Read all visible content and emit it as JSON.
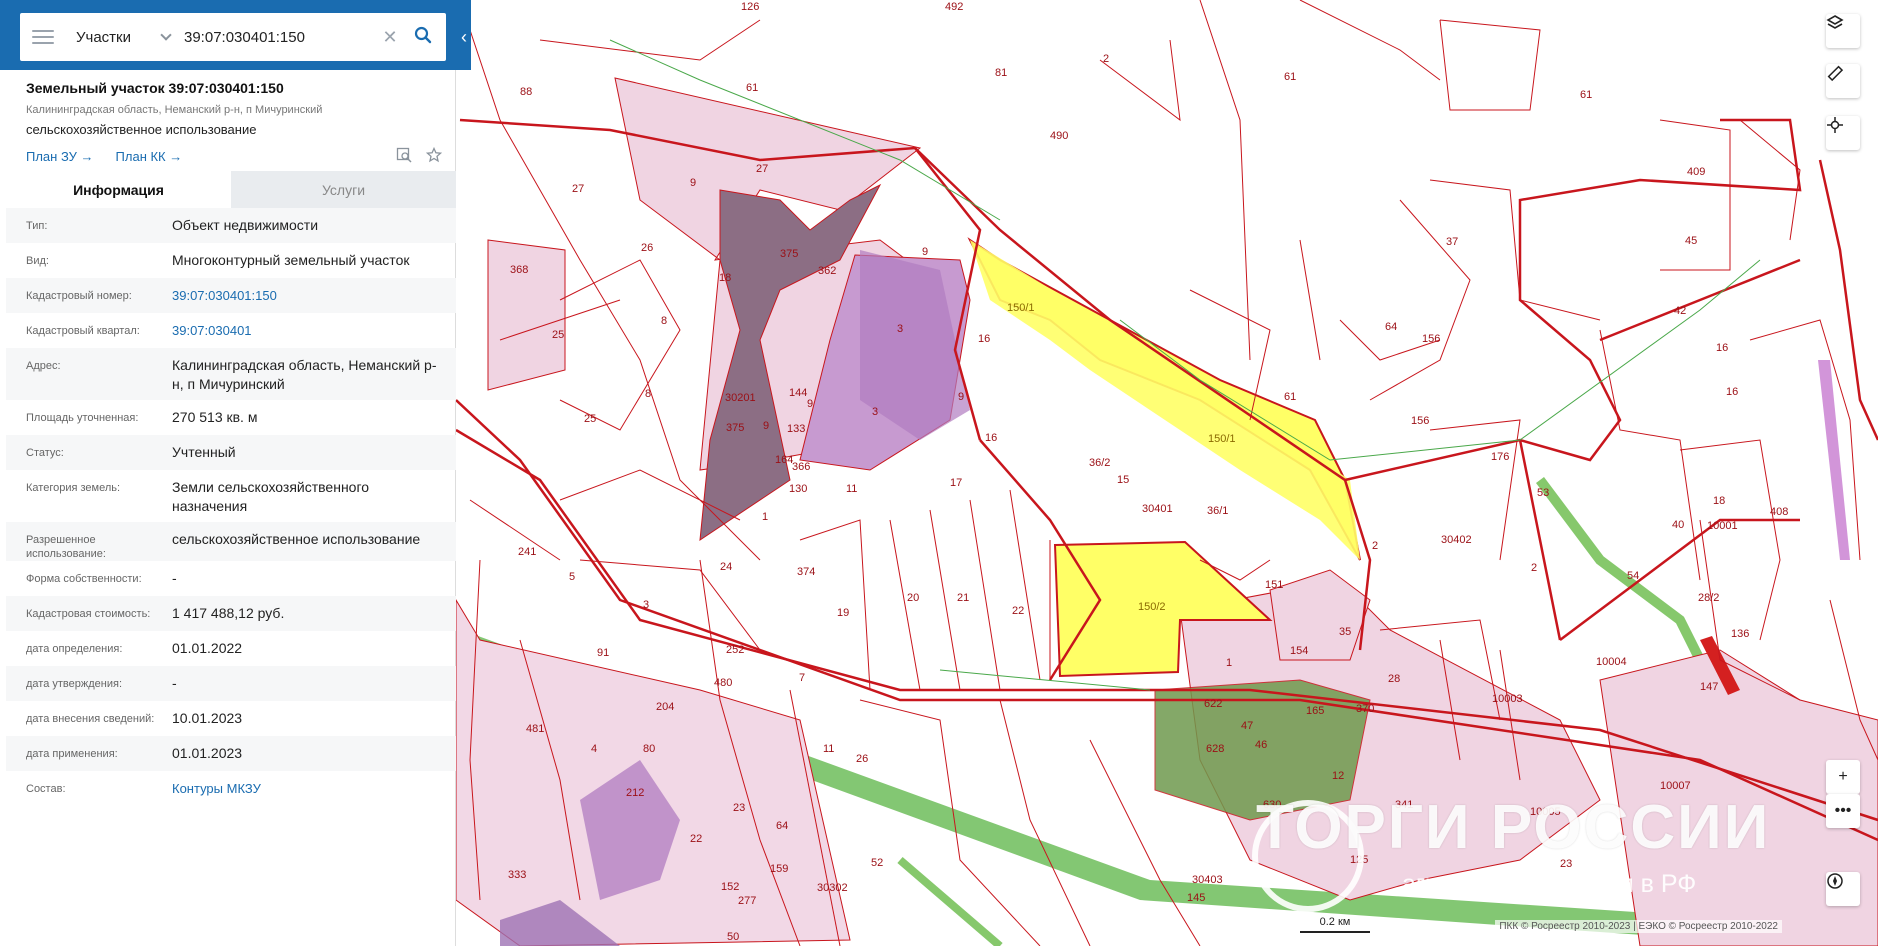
{
  "search": {
    "type_label": "Участки",
    "value": "39:07:030401:150"
  },
  "object": {
    "title": "Земельный участок 39:07:030401:150",
    "address_short": "Калининградская область, Неманский р-н, п Мичуринский",
    "use": "сельскохозяйственное использование",
    "plan_zu": "План ЗУ →",
    "plan_kk": "План КК →"
  },
  "tabs": [
    {
      "label": "Информация",
      "active": true
    },
    {
      "label": "Услуги",
      "active": false
    }
  ],
  "properties": [
    {
      "label": "Тип:",
      "value": "Объект недвижимости",
      "link": false
    },
    {
      "label": "Вид:",
      "value": "Многоконтурный земельный участок",
      "link": false
    },
    {
      "label": "Кадастровый номер:",
      "value": "39:07:030401:150",
      "link": true
    },
    {
      "label": "Кадастровый квартал:",
      "value": "39:07:030401",
      "link": true
    },
    {
      "label": "Адрес:",
      "value": "Калининградская область, Неманский р-н, п Мичуринский",
      "link": false
    },
    {
      "label": "Площадь уточненная:",
      "value": "270 513 кв. м",
      "link": false
    },
    {
      "label": "Статус:",
      "value": "Учтенный",
      "link": false
    },
    {
      "label": "Категория земель:",
      "value": "Земли сельскохозяйственного назначения",
      "link": false
    },
    {
      "label": "Разрешенное использование:",
      "value": "сельскохозяйственное использование",
      "link": false
    },
    {
      "label": "Форма собственности:",
      "value": "-",
      "link": false
    },
    {
      "label": "Кадастровая стоимость:",
      "value": "1 417 488,12 руб.",
      "link": false
    },
    {
      "label": "дата определения:",
      "value": "01.01.2022",
      "link": false
    },
    {
      "label": "дата утверждения:",
      "value": "-",
      "link": false
    },
    {
      "label": "дата внесения сведений:",
      "value": "10.01.2023",
      "link": false
    },
    {
      "label": "дата применения:",
      "value": "01.01.2023",
      "link": false
    },
    {
      "label": "Состав:",
      "value": "Контуры МКЗУ",
      "link": true
    }
  ],
  "map": {
    "scale_label": "0.2 км",
    "copyright": "ПКК © Росреестр 2010-2023 | ЕЭКО © Росреестр 2010-2022",
    "watermark": "ТОРГИ РОССИИ",
    "watermark_sub": "агрегатор по торгам в РФ",
    "labels": [
      "126",
      "492",
      "2",
      "61",
      "88",
      "61",
      "81",
      "490",
      "61",
      "27",
      "27",
      "9",
      "375",
      "362",
      "9",
      "26",
      "18",
      "368",
      "25",
      "8",
      "3",
      "8",
      "25",
      "9",
      "3",
      "150/1",
      "16",
      "64",
      "37",
      "409",
      "45",
      "42",
      "156",
      "16",
      "16",
      "61",
      "156",
      "150/1",
      "30201",
      "144",
      "9",
      "375",
      "133",
      "9",
      "164",
      "366",
      "130",
      "1",
      "11",
      "17",
      "16",
      "36/2",
      "15",
      "30401",
      "36/1",
      "176",
      "53",
      "18",
      "408",
      "40",
      "10001",
      "241",
      "5",
      "24",
      "374",
      "19",
      "20",
      "21",
      "22",
      "150/2",
      "151",
      "2",
      "30402",
      "54",
      "28/2",
      "136",
      "3",
      "91",
      "252",
      "480",
      "7",
      "35",
      "154",
      "1",
      "28",
      "10003",
      "10004",
      "147",
      "481",
      "4",
      "204",
      "11",
      "26",
      "622",
      "47",
      "628",
      "165",
      "46",
      "12",
      "630",
      "10005",
      "10007",
      "80",
      "212",
      "22",
      "64",
      "52",
      "30302",
      "341",
      "125",
      "23",
      "30403",
      "145",
      "333",
      "481",
      "50",
      "277",
      "152",
      "159",
      "23",
      "370"
    ],
    "colors": {
      "boundary": "#c8161d",
      "selected": "#ffff66",
      "pink": "#f0d4e2",
      "purple": "#b07cc0",
      "dark": "#8a6a80",
      "green": "#7bbf5e",
      "forest": "#6f9a4e"
    }
  },
  "icons": [
    "menu-icon",
    "chevron-down-icon",
    "clear-icon",
    "search-icon",
    "collapse-icon",
    "preview-icon",
    "star-icon",
    "layers-icon",
    "ruler-icon",
    "locate-icon",
    "zoom-in-icon",
    "more-icon",
    "compass-icon"
  ]
}
